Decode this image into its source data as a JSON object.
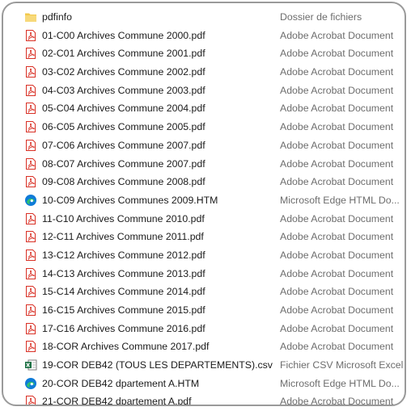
{
  "colors": {
    "name_text": "#1a1a1a",
    "type_text": "#6d6d6d",
    "frame_border": "#9a9a9a",
    "pdf_icon_red": "#d93025",
    "folder_yellow": "#f2c94c",
    "edge_blue": "#0f7bd8",
    "edge_green": "#2fbf71",
    "excel_green": "#1e7145"
  },
  "files": [
    {
      "name": "pdfinfo",
      "type": "Dossier de fichiers",
      "icon": "folder-icon"
    },
    {
      "name": "01-C00 Archives Commune 2000.pdf",
      "type": "Adobe Acrobat Document",
      "icon": "pdf-icon"
    },
    {
      "name": "02-C01 Archives Commune 2001.pdf",
      "type": "Adobe Acrobat Document",
      "icon": "pdf-icon"
    },
    {
      "name": "03-C02 Archives Commune 2002.pdf",
      "type": "Adobe Acrobat Document",
      "icon": "pdf-icon"
    },
    {
      "name": "04-C03 Archives Commune 2003.pdf",
      "type": "Adobe Acrobat Document",
      "icon": "pdf-icon"
    },
    {
      "name": "05-C04 Archives Commune 2004.pdf",
      "type": "Adobe Acrobat Document",
      "icon": "pdf-icon"
    },
    {
      "name": "06-C05 Archives Commune 2005.pdf",
      "type": "Adobe Acrobat Document",
      "icon": "pdf-icon"
    },
    {
      "name": "07-C06 Archives Commune 2007.pdf",
      "type": "Adobe Acrobat Document",
      "icon": "pdf-icon"
    },
    {
      "name": "08-C07 Archives Commune 2007.pdf",
      "type": "Adobe Acrobat Document",
      "icon": "pdf-icon"
    },
    {
      "name": "09-C08 Archives Commune 2008.pdf",
      "type": "Adobe Acrobat Document",
      "icon": "pdf-icon"
    },
    {
      "name": "10-C09 Archives Communes 2009.HTM",
      "type": "Microsoft Edge HTML Do...",
      "icon": "edge-icon"
    },
    {
      "name": "11-C10 Archives Commune 2010.pdf",
      "type": "Adobe Acrobat Document",
      "icon": "pdf-icon"
    },
    {
      "name": "12-C11 Archives Commune 2011.pdf",
      "type": "Adobe Acrobat Document",
      "icon": "pdf-icon"
    },
    {
      "name": "13-C12 Archives Commune 2012.pdf",
      "type": "Adobe Acrobat Document",
      "icon": "pdf-icon"
    },
    {
      "name": "14-C13 Archives Commune 2013.pdf",
      "type": "Adobe Acrobat Document",
      "icon": "pdf-icon"
    },
    {
      "name": "15-C14 Archives Commune 2014.pdf",
      "type": "Adobe Acrobat Document",
      "icon": "pdf-icon"
    },
    {
      "name": "16-C15 Archives Commune 2015.pdf",
      "type": "Adobe Acrobat Document",
      "icon": "pdf-icon"
    },
    {
      "name": "17-C16 Archives Commune 2016.pdf",
      "type": "Adobe Acrobat Document",
      "icon": "pdf-icon"
    },
    {
      "name": "18-COR Archives Commune 2017.pdf",
      "type": "Adobe Acrobat Document",
      "icon": "pdf-icon"
    },
    {
      "name": "19-COR DEB42 (TOUS LES DEPARTEMENTS).csv",
      "type": "Fichier CSV Microsoft Excel",
      "icon": "excel-csv-icon"
    },
    {
      "name": "20-COR DEB42 dpartement A.HTM",
      "type": "Microsoft Edge HTML Do...",
      "icon": "edge-icon"
    },
    {
      "name": "21-COR DEB42 dpartement A.pdf",
      "type": "Adobe Acrobat Document",
      "icon": "pdf-icon"
    }
  ]
}
